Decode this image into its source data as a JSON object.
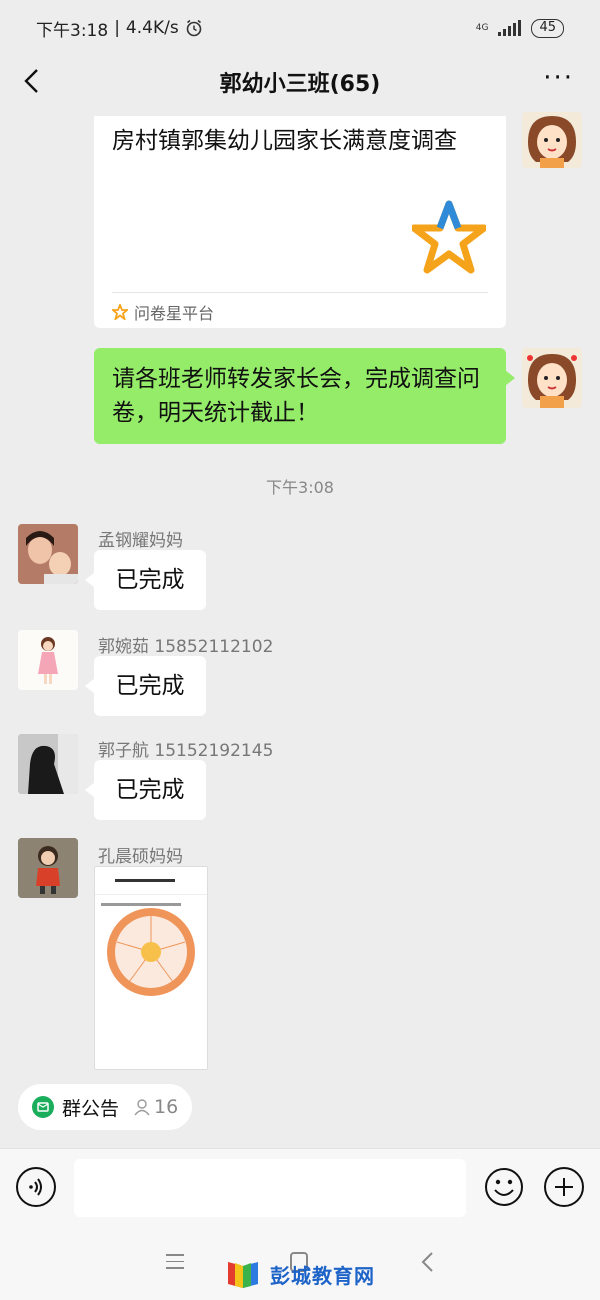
{
  "status_bar": {
    "time": "下午3:18",
    "speed": "4.4K/s",
    "network": "4G",
    "battery": "45"
  },
  "header": {
    "title": "郭幼小三班(65)",
    "more": "···"
  },
  "messages": {
    "card": {
      "title": "房村镇郭集幼儿园家长满意度调查",
      "source": "问卷星平台"
    },
    "green_bubble": "请各班老师转发家长会，完成调查问卷，明天统计截止！",
    "timestamp": "下午3:08",
    "items": [
      {
        "sender": "孟钢耀妈妈",
        "text": "已完成"
      },
      {
        "sender": "郭婉茹  15852112102",
        "text": "已完成"
      },
      {
        "sender": "郭子航  15152192145",
        "text": "已完成"
      },
      {
        "sender": "孔晨硕妈妈"
      }
    ]
  },
  "bottom": {
    "notice_label": "群公告",
    "notice_count": "16",
    "input_placeholder": ""
  },
  "watermark": "彭城教育网"
}
